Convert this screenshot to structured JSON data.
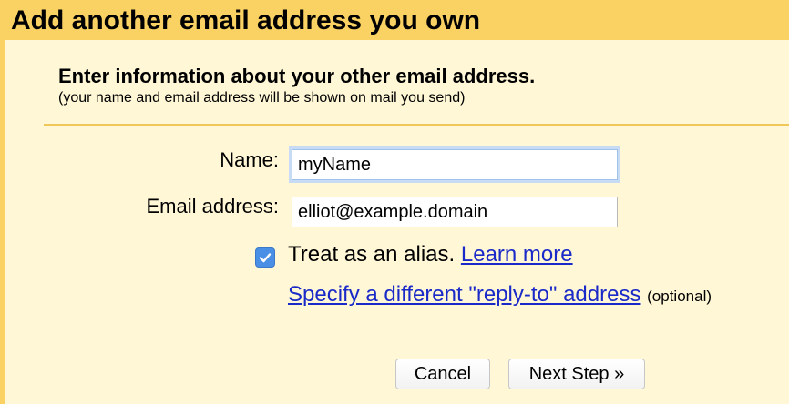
{
  "dialog": {
    "title": "Add another email address you own",
    "heading": "Enter information about your other email address.",
    "subheading": "(your name and email address will be shown on mail you send)"
  },
  "form": {
    "name_label": "Name:",
    "name_value": "myName",
    "email_label": "Email address:",
    "email_value": "elliot@example.domain",
    "alias_checked": true,
    "alias_label": "Treat as an alias.",
    "learn_more": "Learn more",
    "reply_to_link": "Specify a different \"reply-to\" address",
    "reply_to_optional": "(optional)"
  },
  "buttons": {
    "cancel": "Cancel",
    "next": "Next Step »"
  },
  "colors": {
    "title_bar": "#fad163",
    "panel": "#fff7d6",
    "link": "#1a2ac8",
    "checkbox": "#4a8fe6"
  }
}
